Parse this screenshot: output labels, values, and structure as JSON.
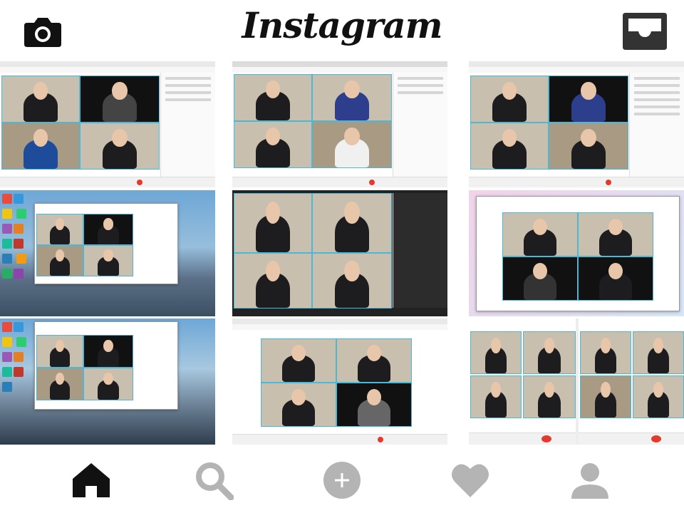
{
  "app": {
    "logo_text": "Instagram"
  },
  "header": {
    "left_icon": "camera-icon",
    "right_icon": "inbox-icon"
  },
  "colors": {
    "icon_dark": "#111111",
    "icon_gray": "#b4b4b4",
    "video_border": "#4cb8d8",
    "leave_red": "#e23b2e"
  },
  "grid": {
    "tiles": [
      {
        "kind": "video-meeting",
        "participants": 4
      },
      {
        "kind": "video-meeting",
        "participants": 4
      },
      {
        "kind": "video-meeting",
        "participants": 4
      },
      {
        "kind": "desktop-meeting",
        "participants": 4
      },
      {
        "kind": "video-meeting",
        "participants": 4
      },
      {
        "kind": "meeting-dialog",
        "participants": 4
      },
      {
        "kind": "desktop-meeting",
        "participants": 4
      },
      {
        "kind": "video-meeting",
        "participants": 4
      },
      {
        "kind": "phone-meeting",
        "participants": 8
      }
    ]
  },
  "bottom_nav": {
    "items": [
      {
        "icon": "home-icon",
        "active": true
      },
      {
        "icon": "search-icon",
        "active": false
      },
      {
        "icon": "add-icon",
        "active": false
      },
      {
        "icon": "heart-icon",
        "active": false
      },
      {
        "icon": "profile-icon",
        "active": false
      }
    ]
  }
}
